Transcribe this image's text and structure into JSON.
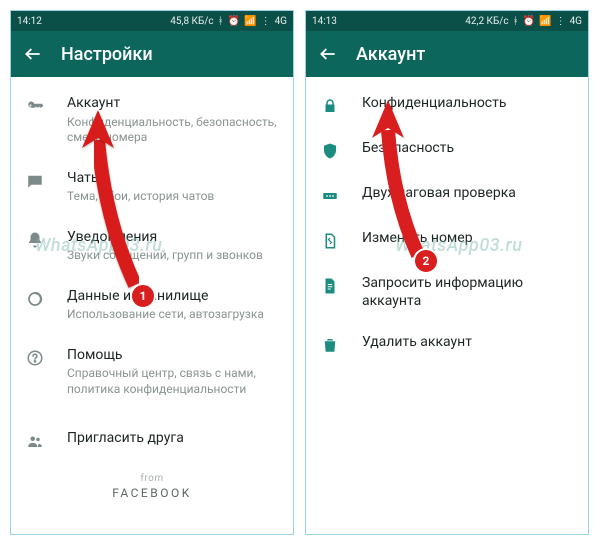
{
  "left": {
    "statusbar": {
      "time": "14:12",
      "speed": "45,8 КБ/с",
      "sig": "4G"
    },
    "appbar": {
      "title": "Настройки"
    },
    "rows": [
      {
        "label": "Аккаунт",
        "sub": "Конфиденциальность, безопасность, смена номера"
      },
      {
        "label": "Чаты",
        "sub": "Тема, обои, история чатов"
      },
      {
        "label": "Уведомления",
        "sub": "Звуки сообщений, групп и звонков"
      },
      {
        "label": "Данные и хранилище",
        "sub": "Использование сети, автозагрузка"
      },
      {
        "label": "Помощь",
        "sub": "Справочный центр, связь с нами, политика конфиденциальности"
      },
      {
        "label": "Пригласить друга"
      }
    ],
    "footer": {
      "from": "from",
      "brand": "FACEBOOK"
    }
  },
  "right": {
    "statusbar": {
      "time": "14:13",
      "speed": "42,2 КБ/с",
      "sig": "4G"
    },
    "appbar": {
      "title": "Аккаунт"
    },
    "rows": [
      {
        "label": "Конфиденциальность"
      },
      {
        "label": "Безопасность"
      },
      {
        "label": "Двухшаговая проверка"
      },
      {
        "label": "Изменить номер"
      },
      {
        "label": "Запросить информацию аккаунта"
      },
      {
        "label": "Удалить аккаунт"
      }
    ]
  },
  "badges": {
    "b1": "1",
    "b2": "2"
  },
  "watermark": "WhatsApp03.ru"
}
